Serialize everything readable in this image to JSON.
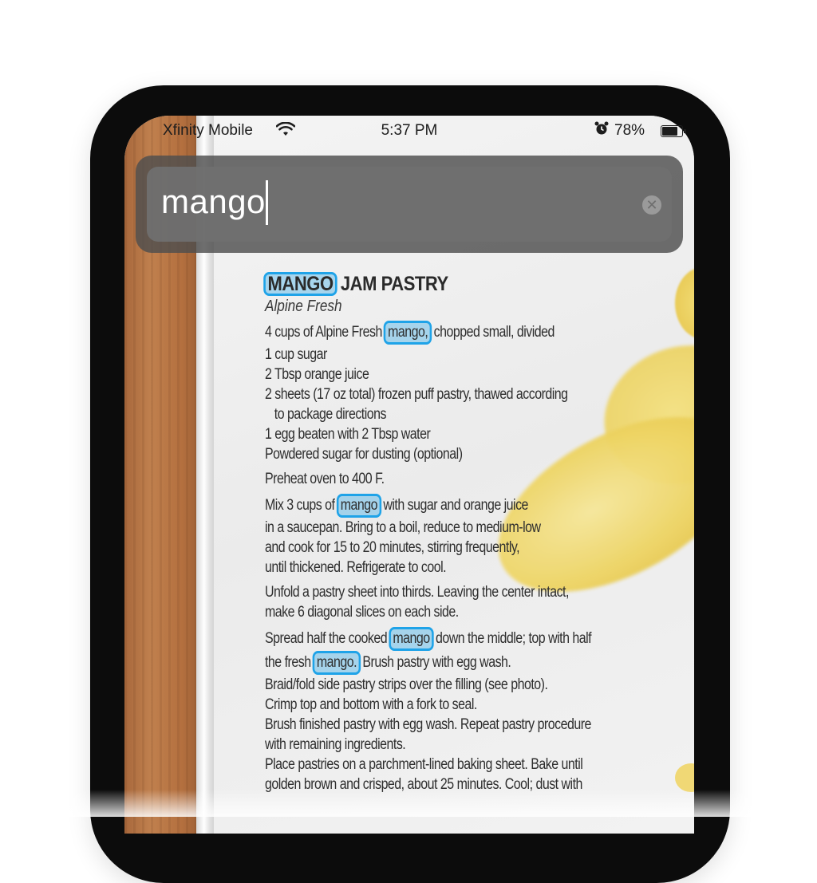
{
  "status_bar": {
    "carrier": "Xfinity Mobile",
    "time": "5:37 PM",
    "battery": "78%",
    "wifi_icon": "wifi-icon",
    "alarm_icon": "alarm-clock-icon"
  },
  "search": {
    "query": "mango",
    "clear_icon": "clear-circle-icon",
    "highlight_color": "#1fa3e8"
  },
  "recipe": {
    "title_highlight": "MANGO",
    "title_rest": " JAM PASTRY",
    "subtitle": "Alpine Fresh",
    "ingredient_1_pre": "4 cups of Alpine Fresh ",
    "ingredient_1_hl": "mango,",
    "ingredient_1_post": " chopped small, divided",
    "ingredient_2": "1 cup sugar",
    "ingredient_3": "2 Tbsp orange juice",
    "ingredient_4a": "2 sheets (17 oz total) frozen puff pastry, thawed according",
    "ingredient_4b": "to package directions",
    "ingredient_5": "1 egg beaten with 2 Tbsp water",
    "ingredient_6": "Powdered sugar for dusting (optional)",
    "step_1": "Preheat oven to 400 F.",
    "step_2_pre": "Mix 3 cups of ",
    "step_2_hl": "mango",
    "step_2_post": " with sugar and orange juice",
    "step_2b": "in a saucepan. Bring to a boil, reduce to medium-low",
    "step_2c": "and cook for 15 to 20 minutes, stirring frequently,",
    "step_2d": "until thickened. Refrigerate to cool.",
    "step_3a": "Unfold a pastry sheet into thirds. Leaving the center intact,",
    "step_3b": "make 6 diagonal slices on each side.",
    "step_4_pre": "Spread half the cooked ",
    "step_4_hl": "mango",
    "step_4_post": " down the middle; top with half",
    "step_4b_pre": "the fresh ",
    "step_4b_hl": "mango.",
    "step_4b_post": " Brush pastry with egg wash.",
    "step_5a": "Braid/fold side pastry strips over the filling (see photo).",
    "step_5b": "Crimp top and bottom with a fork to seal.",
    "step_6a": "Brush finished pastry with egg wash. Repeat pastry procedure",
    "step_6b": "with remaining ingredients.",
    "step_7a": "Place pastries on a parchment-lined baking sheet. Bake until",
    "step_7b": "golden brown and crisped, about 25 minutes. Cool; dust with"
  }
}
